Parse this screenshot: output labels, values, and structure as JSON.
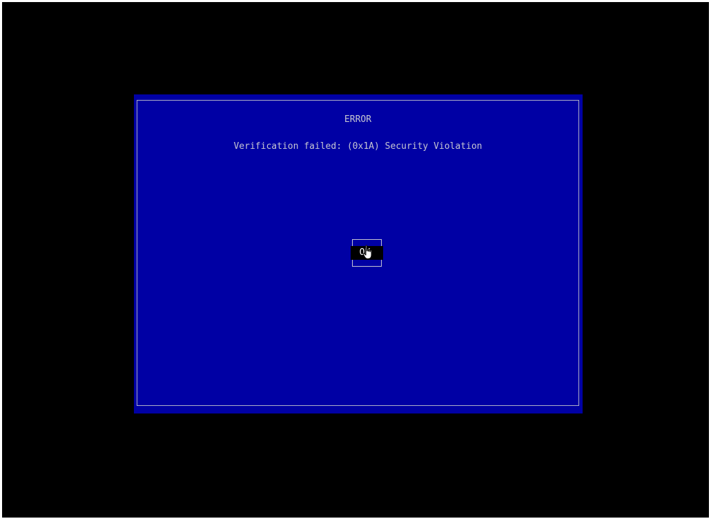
{
  "dialog": {
    "title": "ERROR",
    "message": "Verification failed: (0x1A) Security Violation",
    "ok_label": "OK"
  },
  "cursor": {
    "icon": "hand-pointer-icon"
  },
  "colors": {
    "background": "#000000",
    "dialog_fill": "#0000a4",
    "text": "#c6c6d2",
    "button_fill": "#000000"
  }
}
